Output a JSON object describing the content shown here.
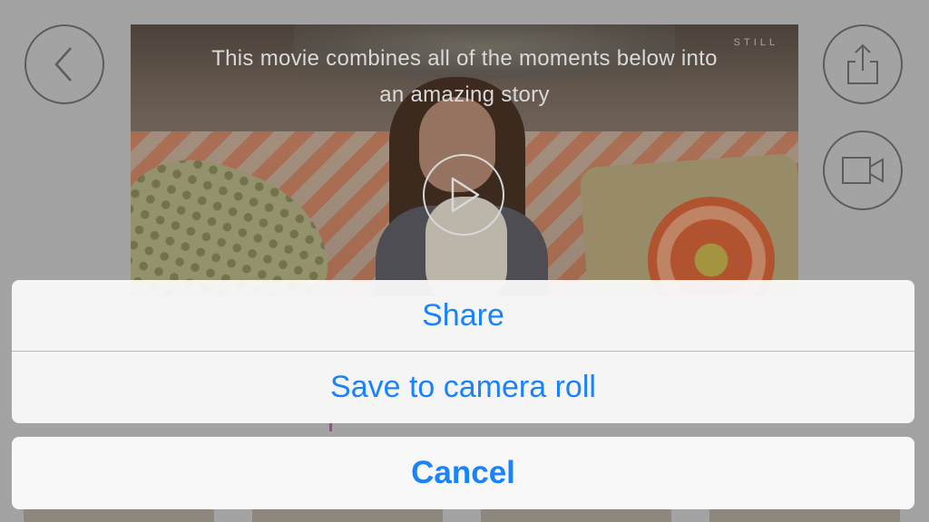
{
  "video": {
    "caption_line1": "This movie combines all of the moments below into",
    "caption_line2": "an amazing story",
    "watermark": "STILL"
  },
  "icons": {
    "back": "chevron-left-icon",
    "share": "share-icon",
    "camera": "video-camera-icon",
    "play": "play-icon"
  },
  "action_sheet": {
    "share_label": "Share",
    "save_label": "Save to camera roll",
    "cancel_label": "Cancel"
  },
  "colors": {
    "accent": "#1a82fb",
    "dim_background": "#a3a3a3"
  }
}
